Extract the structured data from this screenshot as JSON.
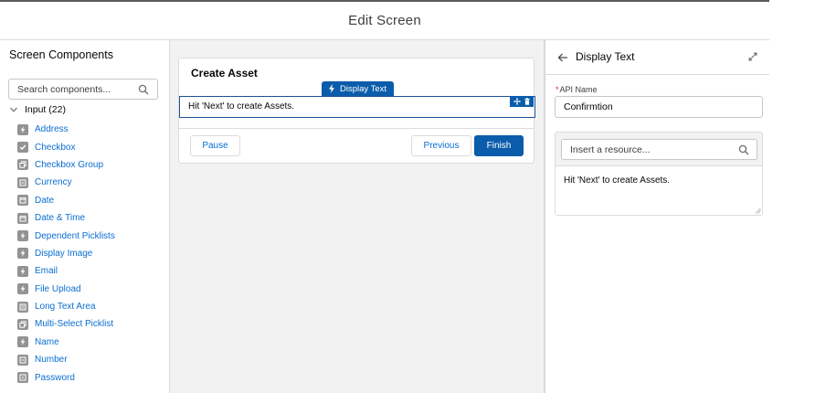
{
  "header": {
    "title": "Edit Screen"
  },
  "sidebar": {
    "title": "Screen Components",
    "search_placeholder": "Search components...",
    "group_label": "Input (22)",
    "items": [
      {
        "label": "Address",
        "icon": "bolt-icon"
      },
      {
        "label": "Checkbox",
        "icon": "checkbox-icon"
      },
      {
        "label": "Checkbox Group",
        "icon": "checkbox-group-icon"
      },
      {
        "label": "Currency",
        "icon": "currency-icon"
      },
      {
        "label": "Date",
        "icon": "calendar-icon"
      },
      {
        "label": "Date & Time",
        "icon": "calendar-icon"
      },
      {
        "label": "Dependent Picklists",
        "icon": "bolt-icon"
      },
      {
        "label": "Display Image",
        "icon": "bolt-icon"
      },
      {
        "label": "Email",
        "icon": "bolt-icon"
      },
      {
        "label": "File Upload",
        "icon": "bolt-icon"
      },
      {
        "label": "Long Text Area",
        "icon": "text-area-icon"
      },
      {
        "label": "Multi-Select Picklist",
        "icon": "multi-picklist-icon"
      },
      {
        "label": "Name",
        "icon": "bolt-icon"
      },
      {
        "label": "Number",
        "icon": "number-icon"
      },
      {
        "label": "Password",
        "icon": "password-icon"
      }
    ]
  },
  "canvas": {
    "screen_title": "Create Asset",
    "selected_component_badge": "Display Text",
    "field_text": "Hit 'Next' to create Assets.",
    "buttons": {
      "pause": "Pause",
      "previous": "Previous",
      "finish": "Finish"
    }
  },
  "properties": {
    "title": "Display Text",
    "api_name_label": "API Name",
    "api_name_value": "Confirmtion",
    "resource_placeholder": "Insert a resource...",
    "text_value": "Hit 'Next' to create Assets."
  },
  "colors": {
    "brand": "#0b5cab",
    "link": "#0a6ed1",
    "canvas_bg": "#f3f2f2",
    "required": "#c23934"
  }
}
